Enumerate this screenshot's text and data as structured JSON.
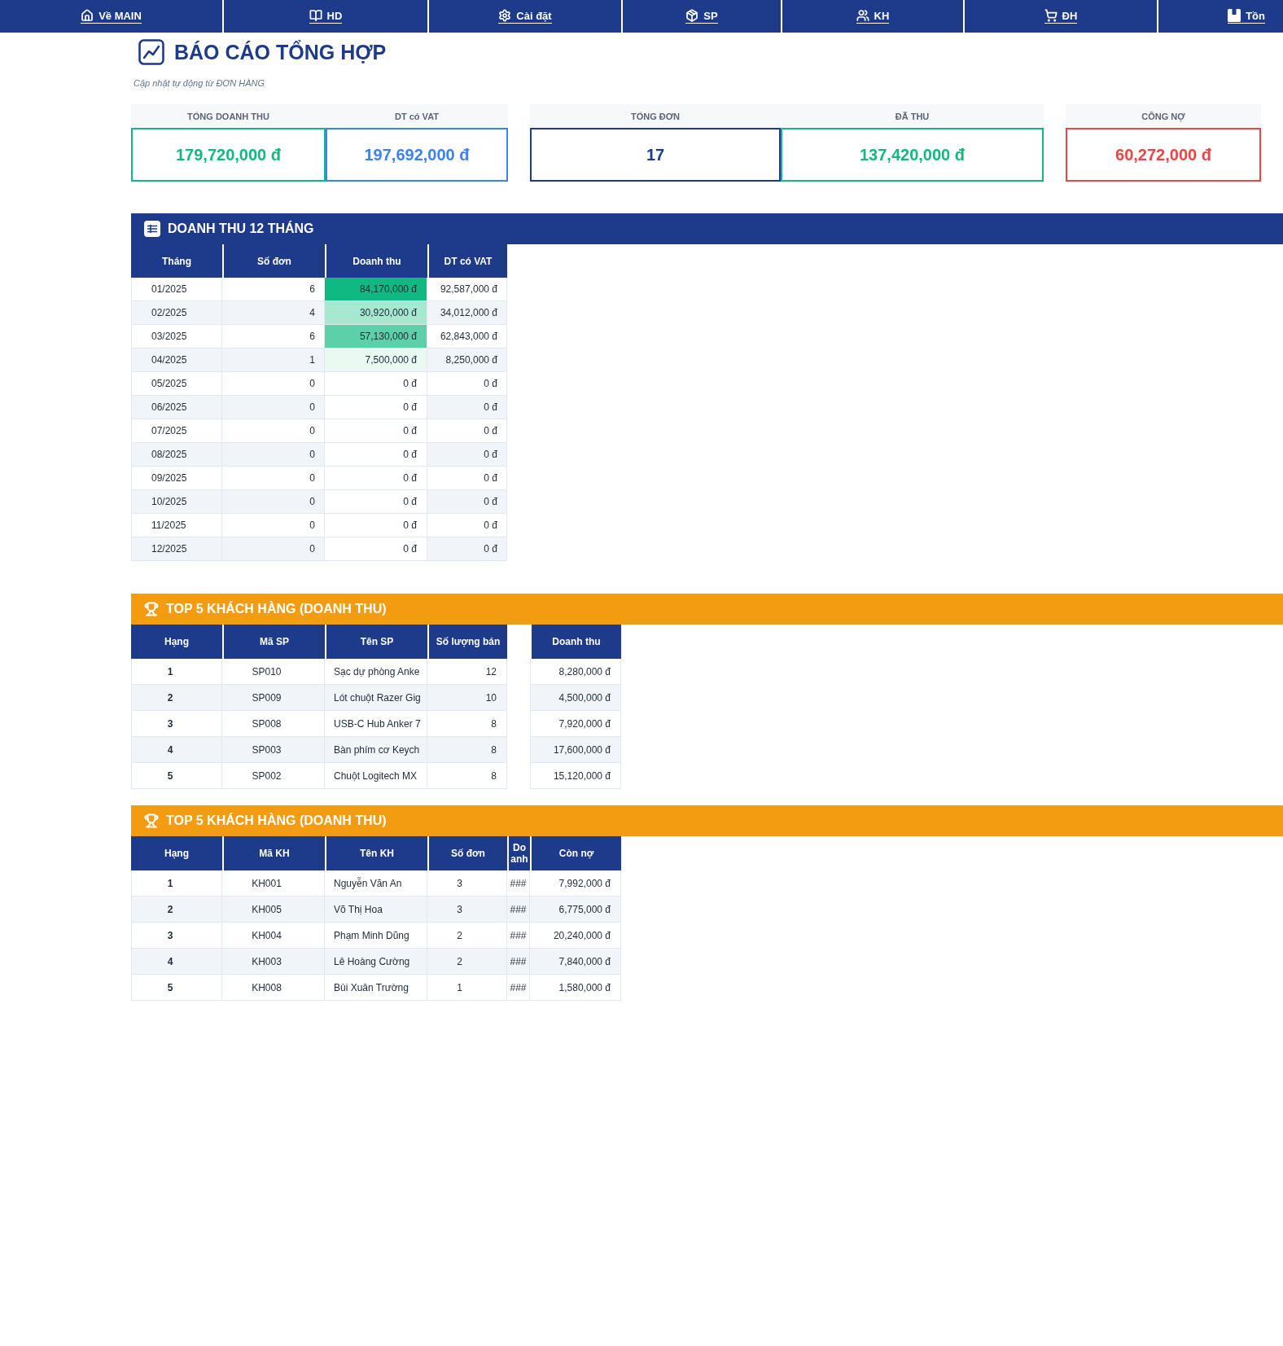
{
  "nav": [
    "Về MAIN",
    "HD",
    "Cài đặt",
    "SP",
    "KH",
    "ĐH",
    "Tồn"
  ],
  "title": "BÁO CÁO TỔNG HỢP",
  "subtitle": "Cập nhật tự động từ ĐƠN HÀNG",
  "kpi_groups": [
    [
      {
        "label": "TỔNG DOANH THU",
        "value": "179,720,000 đ",
        "color": "#10b981"
      },
      {
        "label": "DT có VAT",
        "value": "197,692,000 đ",
        "color": "#3b82f6"
      }
    ],
    [
      {
        "label": "TỔNG ĐƠN",
        "value": "17",
        "color": "#1e3a8a"
      },
      {
        "label": "ĐÃ THU",
        "value": "137,420,000 đ",
        "color": "#10b981"
      }
    ],
    [
      {
        "label": "CÔNG NỢ",
        "value": "60,272,000 đ",
        "color": "#ef4444"
      }
    ]
  ],
  "monthly": {
    "title": "DOANH THU 12 THÁNG",
    "columns": [
      "Tháng",
      "Số đơn",
      "Doanh thu",
      "DT có VAT"
    ],
    "rows": [
      {
        "month": "01/2025",
        "orders": "6",
        "revenue": "84,170,000 đ",
        "vat": "92,587,000 đ",
        "color": "#10b981"
      },
      {
        "month": "02/2025",
        "orders": "4",
        "revenue": "30,920,000 đ",
        "vat": "34,012,000 đ",
        "color": "#a7e8d1"
      },
      {
        "month": "03/2025",
        "orders": "6",
        "revenue": "57,130,000 đ",
        "vat": "62,843,000 đ",
        "color": "#5cd0a8"
      },
      {
        "month": "04/2025",
        "orders": "1",
        "revenue": "7,500,000 đ",
        "vat": "8,250,000 đ",
        "color": "#eafaf3"
      },
      {
        "month": "05/2025",
        "orders": "0",
        "revenue": "0 đ",
        "vat": "0 đ",
        "color": "#ffffff"
      },
      {
        "month": "06/2025",
        "orders": "0",
        "revenue": "0 đ",
        "vat": "0 đ",
        "color": "#ffffff"
      },
      {
        "month": "07/2025",
        "orders": "0",
        "revenue": "0 đ",
        "vat": "0 đ",
        "color": "#ffffff"
      },
      {
        "month": "08/2025",
        "orders": "0",
        "revenue": "0 đ",
        "vat": "0 đ",
        "color": "#ffffff"
      },
      {
        "month": "09/2025",
        "orders": "0",
        "revenue": "0 đ",
        "vat": "0 đ",
        "color": "#ffffff"
      },
      {
        "month": "10/2025",
        "orders": "0",
        "revenue": "0 đ",
        "vat": "0 đ",
        "color": "#ffffff"
      },
      {
        "month": "11/2025",
        "orders": "0",
        "revenue": "0 đ",
        "vat": "0 đ",
        "color": "#ffffff"
      },
      {
        "month": "12/2025",
        "orders": "0",
        "revenue": "0 đ",
        "vat": "0 đ",
        "color": "#ffffff"
      }
    ]
  },
  "top_products": {
    "title": "TOP 5 KHÁCH HÀNG (DOANH THU)",
    "columns": [
      "Hạng",
      "Mã SP",
      "Tên SP",
      "Số lượng bán",
      "Doanh thu"
    ],
    "rows": [
      {
        "rank": "1",
        "code": "SP010",
        "name": "Sạc dự phòng Anke",
        "qty": "12",
        "revenue": "8,280,000 đ"
      },
      {
        "rank": "2",
        "code": "SP009",
        "name": "Lót chuột Razer Gig",
        "qty": "10",
        "revenue": "4,500,000 đ"
      },
      {
        "rank": "3",
        "code": "SP008",
        "name": "USB-C Hub Anker 7",
        "qty": "8",
        "revenue": "7,920,000 đ"
      },
      {
        "rank": "4",
        "code": "SP003",
        "name": "Bàn phím cơ Keych",
        "qty": "8",
        "revenue": "17,600,000 đ"
      },
      {
        "rank": "5",
        "code": "SP002",
        "name": "Chuột Logitech MX",
        "qty": "8",
        "revenue": "15,120,000 đ"
      }
    ]
  },
  "top_customers": {
    "title": "TOP 5 KHÁCH HÀNG (DOANH THU)",
    "columns": [
      "Hạng",
      "Mã KH",
      "Tên KH",
      "Số đơn",
      "Do anh",
      "Còn nợ"
    ],
    "rows": [
      {
        "rank": "1",
        "code": "KH001",
        "name": "Nguyễn Văn An",
        "orders": "3",
        "column_5": "###",
        "debt": "7,992,000 đ"
      },
      {
        "rank": "2",
        "code": "KH005",
        "name": "Võ Thị Hoa",
        "orders": "3",
        "column_5": "###",
        "debt": "6,775,000 đ"
      },
      {
        "rank": "3",
        "code": "KH004",
        "name": "Phạm Minh Dũng",
        "orders": "2",
        "column_5": "###",
        "debt": "20,240,000 đ"
      },
      {
        "rank": "4",
        "code": "KH003",
        "name": "Lê Hoàng Cường",
        "orders": "2",
        "column_5": "###",
        "debt": "7,840,000 đ"
      },
      {
        "rank": "5",
        "code": "KH008",
        "name": "Bùi Xuân Trường",
        "orders": "1",
        "column_5": "###",
        "debt": "1,580,000 đ"
      }
    ]
  }
}
